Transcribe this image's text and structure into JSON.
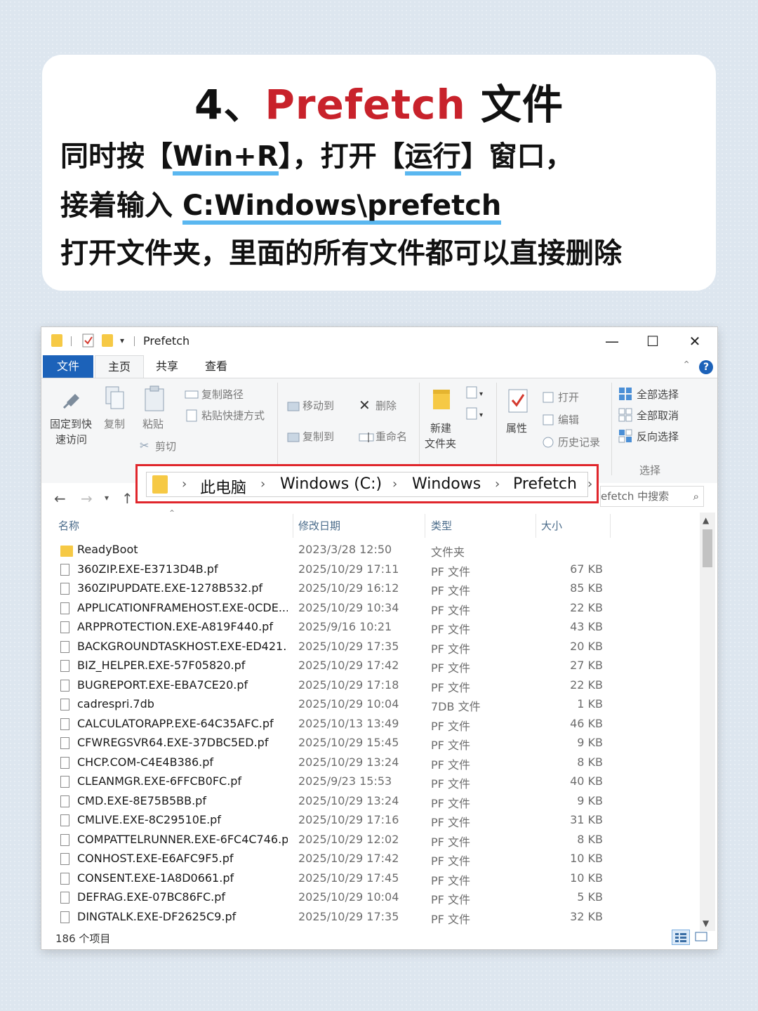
{
  "card": {
    "title_num": "4、",
    "title_red": "Prefetch",
    "title_rest": " 文件",
    "line1_a": "同时按【",
    "line1_b": "Win+R",
    "line1_c": "】，打开【",
    "line1_d": "运行",
    "line1_e": "】窗口，",
    "line2_a": "接着输入 ",
    "line2_b": "C:Windows\\prefetch",
    "line3": "打开文件夹，里面的所有文件都可以直接删除"
  },
  "window": {
    "title": "Prefetch",
    "min": "—",
    "max": "☐",
    "close": "✕"
  },
  "tabs": {
    "file": "文件",
    "home": "主页",
    "share": "共享",
    "view": "查看",
    "help": "?"
  },
  "ribbon": {
    "pin1": "固定到快",
    "pin2": "速访问",
    "copy": "复制",
    "paste": "粘贴",
    "copy_path": "复制路径",
    "paste_shortcut": "粘贴快捷方式",
    "cut": "剪切",
    "move_to": "移动到",
    "copy_to": "复制到",
    "delete": "删除",
    "rename": "重命名",
    "new1": "新建",
    "new2": "文件夹",
    "properties": "属性",
    "open": "打开",
    "edit": "编辑",
    "history": "历史记录",
    "select_all": "全部选择",
    "select_none": "全部取消",
    "invert": "反向选择",
    "select_group": "选择"
  },
  "nav": {
    "crumbs": [
      "此电脑",
      "Windows (C:)",
      "Windows",
      "Prefetch"
    ],
    "search_placeholder": "efetch 中搜索"
  },
  "columns": {
    "name": "名称",
    "date": "修改日期",
    "type": "类型",
    "size": "大小"
  },
  "files": [
    {
      "name": "ReadyBoot",
      "date": "2023/3/28 12:50",
      "type": "文件夹",
      "size": "",
      "folder": true
    },
    {
      "name": "360ZIP.EXE-E3713D4B.pf",
      "date": "2025/10/29 17:11",
      "type": "PF 文件",
      "size": "67 KB"
    },
    {
      "name": "360ZIPUPDATE.EXE-1278B532.pf",
      "date": "2025/10/29 16:12",
      "type": "PF 文件",
      "size": "85 KB"
    },
    {
      "name": "APPLICATIONFRAMEHOST.EXE-0CDE...",
      "date": "2025/10/29 10:34",
      "type": "PF 文件",
      "size": "22 KB"
    },
    {
      "name": "ARPPROTECTION.EXE-A819F440.pf",
      "date": "2025/9/16 10:21",
      "type": "PF 文件",
      "size": "43 KB"
    },
    {
      "name": "BACKGROUNDTASKHOST.EXE-ED421...",
      "date": "2025/10/29 17:35",
      "type": "PF 文件",
      "size": "20 KB"
    },
    {
      "name": "BIZ_HELPER.EXE-57F05820.pf",
      "date": "2025/10/29 17:42",
      "type": "PF 文件",
      "size": "27 KB"
    },
    {
      "name": "BUGREPORT.EXE-EBA7CE20.pf",
      "date": "2025/10/29 17:18",
      "type": "PF 文件",
      "size": "22 KB"
    },
    {
      "name": "cadrespri.7db",
      "date": "2025/10/29 10:04",
      "type": "7DB 文件",
      "size": "1 KB"
    },
    {
      "name": "CALCULATORAPP.EXE-64C35AFC.pf",
      "date": "2025/10/13 13:49",
      "type": "PF 文件",
      "size": "46 KB"
    },
    {
      "name": "CFWREGSVR64.EXE-37DBC5ED.pf",
      "date": "2025/10/29 15:45",
      "type": "PF 文件",
      "size": "9 KB"
    },
    {
      "name": "CHCP.COM-C4E4B386.pf",
      "date": "2025/10/29 13:24",
      "type": "PF 文件",
      "size": "8 KB"
    },
    {
      "name": "CLEANMGR.EXE-6FFCB0FC.pf",
      "date": "2025/9/23 15:53",
      "type": "PF 文件",
      "size": "40 KB"
    },
    {
      "name": "CMD.EXE-8E75B5BB.pf",
      "date": "2025/10/29 13:24",
      "type": "PF 文件",
      "size": "9 KB"
    },
    {
      "name": "CMLIVE.EXE-8C29510E.pf",
      "date": "2025/10/29 17:16",
      "type": "PF 文件",
      "size": "31 KB"
    },
    {
      "name": "COMPATTELRUNNER.EXE-6FC4C746.pf",
      "date": "2025/10/29 12:02",
      "type": "PF 文件",
      "size": "8 KB"
    },
    {
      "name": "CONHOST.EXE-E6AFC9F5.pf",
      "date": "2025/10/29 17:42",
      "type": "PF 文件",
      "size": "10 KB"
    },
    {
      "name": "CONSENT.EXE-1A8D0661.pf",
      "date": "2025/10/29 17:45",
      "type": "PF 文件",
      "size": "10 KB"
    },
    {
      "name": "DEFRAG.EXE-07BC86FC.pf",
      "date": "2025/10/29 10:04",
      "type": "PF 文件",
      "size": "5 KB"
    },
    {
      "name": "DINGTALK.EXE-DF2625C9.pf",
      "date": "2025/10/29 17:35",
      "type": "PF 文件",
      "size": "32 KB"
    }
  ],
  "status": {
    "count": "186 个项目"
  },
  "icons": {
    "back": "arrow-left-icon",
    "forward": "arrow-right-icon",
    "up": "arrow-up-icon",
    "search": "search-icon",
    "folder": "folder-icon",
    "file": "file-icon"
  },
  "colors": {
    "accent": "#1c62b9",
    "highlight": "#e0262c",
    "title_red": "#c8222b",
    "underline": "#5ab7f0"
  }
}
